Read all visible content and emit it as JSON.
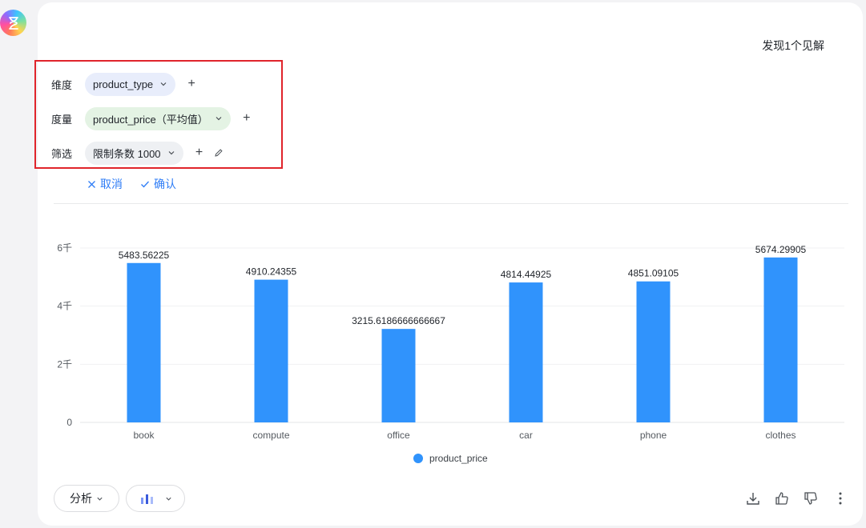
{
  "insight_link": "发现1个见解",
  "config": {
    "dimension": {
      "label": "维度",
      "value": "product_type"
    },
    "measure": {
      "label": "度量",
      "value": "product_price（平均值）"
    },
    "filter": {
      "label": "筛选",
      "value": "限制条数  1000"
    }
  },
  "actions": {
    "cancel": "取消",
    "confirm": "确认"
  },
  "bottom": {
    "analyze": "分析"
  },
  "colors": {
    "bar": "#3093fc",
    "accent": "#2f7df6",
    "highlight_border": "#e0242b"
  },
  "chart_data": {
    "type": "bar",
    "categories": [
      "book",
      "compute",
      "office",
      "car",
      "phone",
      "clothes"
    ],
    "series": [
      {
        "name": "product_price",
        "values": [
          5483.56225,
          4910.24355,
          3215.6186666666667,
          4814.44925,
          4851.09105,
          5674.29905
        ]
      }
    ],
    "data_labels": [
      "5483.56225",
      "4910.24355",
      "3215.6186666666667",
      "4814.44925",
      "4851.09105",
      "5674.29905"
    ],
    "y_ticks": [
      0,
      2000,
      4000,
      6000
    ],
    "y_tick_labels": [
      "0",
      "2千",
      "4千",
      "6千"
    ],
    "ylim": [
      0,
      6000
    ],
    "grid": true,
    "legend": "bottom-center"
  }
}
